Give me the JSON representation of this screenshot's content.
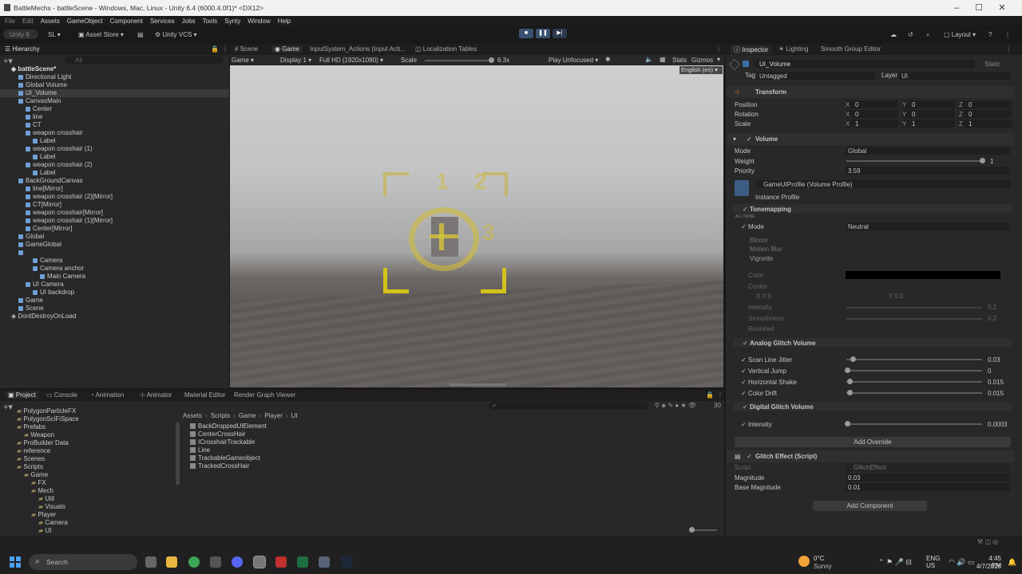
{
  "window": {
    "title": "BattleMechs - battleScene - Windows, Mac, Linux - Unity 6.4 (6000.4.0f1)* <DX12>",
    "min": "–",
    "max": "☐",
    "close": "✕"
  },
  "menu": [
    "File",
    "Edit",
    "Assets",
    "GameObject",
    "Component",
    "Services",
    "Jobs",
    "Tools",
    "Synty",
    "Window",
    "Help"
  ],
  "toolbar": {
    "account": "Unity 6",
    "sl": "SL",
    "asset_store": "Asset Store",
    "vcs": "Unity VCS",
    "layout": "Layout"
  },
  "hierarchy": {
    "tab": "Hierarchy",
    "search": "All",
    "items": [
      {
        "t": "battleScene*",
        "d": 0,
        "b": true
      },
      {
        "t": "Directional Light",
        "d": 1
      },
      {
        "t": "Global Volume",
        "d": 1
      },
      {
        "t": "UI_Volume",
        "d": 1
      },
      {
        "t": "CanvasMain",
        "d": 1
      },
      {
        "t": "Center",
        "d": 2
      },
      {
        "t": "line",
        "d": 2
      },
      {
        "t": "CT",
        "d": 2
      },
      {
        "t": "weapon crosshair",
        "d": 2
      },
      {
        "t": "Label",
        "d": 3
      },
      {
        "t": "weapon crosshair (1)",
        "d": 2
      },
      {
        "t": "Label",
        "d": 3
      },
      {
        "t": "weapon crosshair (2)",
        "d": 2
      },
      {
        "t": "Label",
        "d": 3
      },
      {
        "t": "BackGroundCanvas",
        "d": 1
      },
      {
        "t": "line[Mirror]",
        "d": 2
      },
      {
        "t": "weapon crosshair (2)[Mirror]",
        "d": 2
      },
      {
        "t": "CT[Mirror]",
        "d": 2
      },
      {
        "t": "weapon crosshair[Mirror]",
        "d": 2
      },
      {
        "t": "weapon crosshair (1)[Mirror]",
        "d": 2
      },
      {
        "t": "Center[Mirror]",
        "d": 2
      },
      {
        "t": "Global",
        "d": 1
      },
      {
        "t": "GameGlobal",
        "d": 1
      },
      {
        "t": "",
        "d": 1
      },
      {
        "t": "Camera",
        "d": 3
      },
      {
        "t": "Camera anchor",
        "d": 3
      },
      {
        "t": "Main Camera",
        "d": 4
      },
      {
        "t": "UI Camera",
        "d": 2
      },
      {
        "t": "UI backdrop",
        "d": 3
      },
      {
        "t": "Game",
        "d": 1
      },
      {
        "t": "Scene",
        "d": 1
      },
      {
        "t": "DontDestroyOnLoad",
        "d": 0
      }
    ]
  },
  "center_tabs": [
    "Scene",
    "Game",
    "InputSystem_Actions (Input Acti...",
    "Localization Tables"
  ],
  "game_toolbar": {
    "mode": "Game",
    "display": "Display 1",
    "res": "Full HD (1920x1080)",
    "scale": "Scale",
    "scale_val": "6.3x",
    "play": "Play Unfocused",
    "stats": "Stats",
    "gizmos": "Gizmos",
    "lang": "English (en)"
  },
  "hud": {
    "n1": "1",
    "n2": "2",
    "n3": "3"
  },
  "inspector": {
    "tabs": [
      "Inspector",
      "Lighting",
      "Smooth Group Editor"
    ],
    "name": "UI_Volume",
    "static": "Static",
    "tag_label": "Tag",
    "tag": "Untagged",
    "layer_label": "Layer",
    "layer": "UI",
    "transform": {
      "title": "Transform",
      "rows": [
        [
          "Position",
          "0",
          "0",
          "0"
        ],
        [
          "Rotation",
          "0",
          "0",
          "0"
        ],
        [
          "Scale",
          "1",
          "1",
          "1"
        ]
      ]
    },
    "volume": {
      "title": "Volume",
      "mode_label": "Mode",
      "mode": "Global",
      "weight_label": "Weight",
      "weight": "1",
      "priority_label": "Priority",
      "priority": "3.59",
      "profile": "GameUIProfile (Volume Profile)",
      "instance": "Instance Profile"
    },
    "tonemapping": {
      "title": "Tonemapping",
      "all": "ALL",
      "none": "NONE",
      "mode_label": "Mode",
      "mode": "Neutral"
    },
    "collapsed": [
      "Bloom",
      "Motion Blur",
      "Vignette"
    ],
    "vignette": {
      "color": "Color",
      "center": "Center",
      "cx": "0.5",
      "cy": "0.5",
      "intensity": "Intensity",
      "iv": "0.2",
      "smoothness": "Smoothness",
      "sv": "0.2",
      "rounded": "Rounded"
    },
    "analog": {
      "title": "Analog Glitch Volume",
      "rows": [
        [
          "Scan Line Jitter",
          "0.03"
        ],
        [
          "Vertical Jump",
          "0"
        ],
        [
          "Horizontal Shake",
          "0.015"
        ],
        [
          "Color Drift",
          "0.015"
        ]
      ]
    },
    "digital": {
      "title": "Digital Glitch Volume",
      "rows": [
        [
          "Intensity",
          "0.0003"
        ]
      ]
    },
    "add_override": "Add Override",
    "glitch": {
      "title": "Glitch Effect (Script)",
      "script_label": "Script",
      "script": "GlitchEffect",
      "mag_label": "Magnitude",
      "mag": "0.03",
      "base_label": "Base Magnitude",
      "base": "0.01"
    },
    "add_component": "Add Component"
  },
  "bottom_tabs": [
    "Project",
    "Console",
    "Animation",
    "Animator",
    "Material Editor",
    "Render Graph Viewer"
  ],
  "project_tree": [
    [
      "PolygonParticleFX",
      1
    ],
    [
      "PolygonSciFiSpace",
      1
    ],
    [
      "Prefabs",
      1
    ],
    [
      "Weapon",
      2
    ],
    [
      "ProBuilder Data",
      1
    ],
    [
      "reference",
      1
    ],
    [
      "Scenes",
      1
    ],
    [
      "Scripts",
      1
    ],
    [
      "Game",
      2
    ],
    [
      "FX",
      3
    ],
    [
      "Mech",
      3
    ],
    [
      "Util",
      4
    ],
    [
      "Visuals",
      4
    ],
    [
      "Player",
      3
    ],
    [
      "Camera",
      4
    ],
    [
      "UI",
      4
    ]
  ],
  "breadcrumb": [
    "Assets",
    "Scripts",
    "Game",
    "Player",
    "UI"
  ],
  "files": [
    "BackDroppedUIElement",
    "CenterCrossHair",
    "ICrosshairTrackable",
    "Line",
    "TrackableGameobject",
    "TrackedCrossHair"
  ],
  "count": "30",
  "taskbar": {
    "search": "Search",
    "temp": "0°C",
    "weather": "Sunny",
    "lang1": "ENG",
    "lang2": "US",
    "time": "4:45 PM",
    "date": "4/7/2026"
  }
}
